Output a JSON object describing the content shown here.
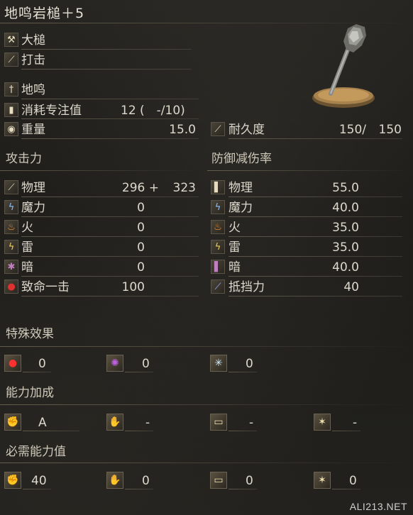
{
  "title": "地鸣岩槌＋5",
  "weapon_type": "大槌",
  "attack_type": "打击",
  "skill": "地鸣",
  "fp_cost": {
    "label": "消耗专注值",
    "value": "12 (　-/10)"
  },
  "weight": {
    "label": "重量",
    "value": "15.0"
  },
  "durability": {
    "label": "耐久度",
    "current": "150/",
    "max": "150"
  },
  "attack": {
    "header": "攻击力",
    "rows": [
      {
        "icon": "physical-attack-icon",
        "label": "物理",
        "value": "296 +",
        "bonus": "323"
      },
      {
        "icon": "magic-attack-icon",
        "label": "魔力",
        "value": "0"
      },
      {
        "icon": "fire-attack-icon",
        "label": "火",
        "value": "0"
      },
      {
        "icon": "lightning-attack-icon",
        "label": "雷",
        "value": "0"
      },
      {
        "icon": "dark-attack-icon",
        "label": "暗",
        "value": "0"
      },
      {
        "icon": "critical-icon",
        "label": "致命一击",
        "value": "100"
      }
    ]
  },
  "defense": {
    "header": "防御减伤率",
    "rows": [
      {
        "icon": "physical-defense-icon",
        "label": "物理",
        "value": "55.0"
      },
      {
        "icon": "magic-defense-icon",
        "label": "魔力",
        "value": "40.0"
      },
      {
        "icon": "fire-defense-icon",
        "label": "火",
        "value": "35.0"
      },
      {
        "icon": "lightning-defense-icon",
        "label": "雷",
        "value": "35.0"
      },
      {
        "icon": "dark-defense-icon",
        "label": "暗",
        "value": "40.0"
      },
      {
        "icon": "stability-icon",
        "label": "抵挡力",
        "value": "40"
      }
    ]
  },
  "special": {
    "header": "特殊效果",
    "items": [
      {
        "icon": "bleed-icon",
        "value": "0"
      },
      {
        "icon": "poison-icon",
        "value": "0"
      },
      {
        "icon": "frost-icon",
        "value": "0"
      }
    ]
  },
  "scaling": {
    "header": "能力加成",
    "items": [
      {
        "icon": "strength-icon",
        "value": "A"
      },
      {
        "icon": "dexterity-icon",
        "value": "-"
      },
      {
        "icon": "intelligence-icon",
        "value": "-"
      },
      {
        "icon": "faith-icon",
        "value": "-"
      }
    ]
  },
  "requirements": {
    "header": "必需能力值",
    "items": [
      {
        "icon": "strength-icon",
        "value": "40"
      },
      {
        "icon": "dexterity-icon",
        "value": "0"
      },
      {
        "icon": "intelligence-icon",
        "value": "0"
      },
      {
        "icon": "faith-icon",
        "value": "0"
      }
    ]
  },
  "watermark": "ALI213.NET",
  "colors": {
    "bleed": "#b01818",
    "poison": "#9a3fb8",
    "frost": "#a8d8ff",
    "text": "#dcd8cc"
  }
}
